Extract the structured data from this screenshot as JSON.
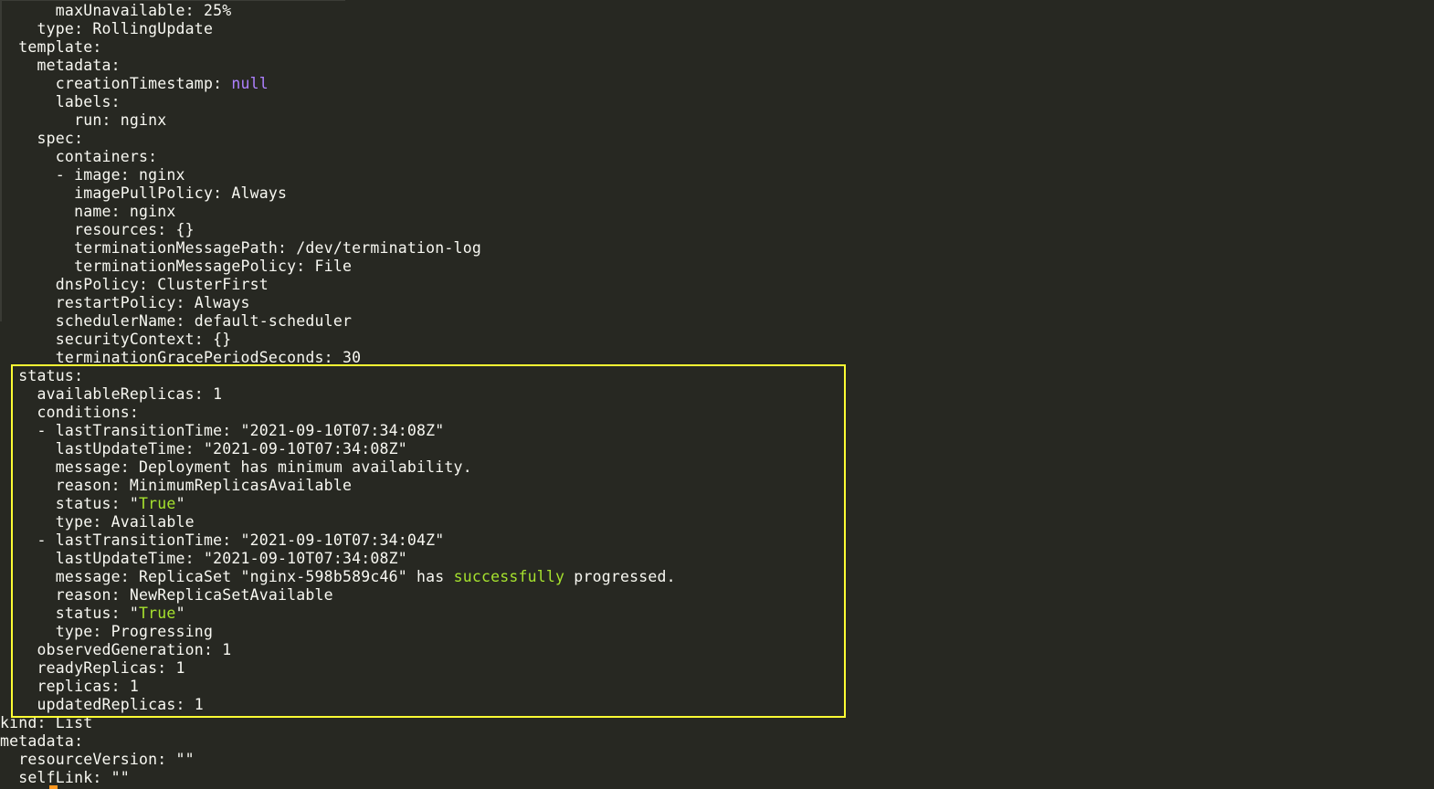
{
  "terminal": {
    "lines": [
      [
        {
          "t": "      maxUnavailable: 25%",
          "c": "text"
        }
      ],
      [
        {
          "t": "    type: RollingUpdate",
          "c": "text"
        }
      ],
      [
        {
          "t": "  template:",
          "c": "text"
        }
      ],
      [
        {
          "t": "    metadata:",
          "c": "text"
        }
      ],
      [
        {
          "t": "      creationTimestamp: ",
          "c": "text"
        },
        {
          "t": "null",
          "c": "null"
        }
      ],
      [
        {
          "t": "      labels:",
          "c": "text"
        }
      ],
      [
        {
          "t": "        run: nginx",
          "c": "text"
        }
      ],
      [
        {
          "t": "    spec:",
          "c": "text"
        }
      ],
      [
        {
          "t": "      containers:",
          "c": "text"
        }
      ],
      [
        {
          "t": "      - image: nginx",
          "c": "text"
        }
      ],
      [
        {
          "t": "        imagePullPolicy: Always",
          "c": "text"
        }
      ],
      [
        {
          "t": "        name: nginx",
          "c": "text"
        }
      ],
      [
        {
          "t": "        resources: {}",
          "c": "text"
        }
      ],
      [
        {
          "t": "        terminationMessagePath: /dev/termination-log",
          "c": "text"
        }
      ],
      [
        {
          "t": "        terminationMessagePolicy: File",
          "c": "text"
        }
      ],
      [
        {
          "t": "      dnsPolicy: ClusterFirst",
          "c": "text"
        }
      ],
      [
        {
          "t": "      restartPolicy: Always",
          "c": "text"
        }
      ],
      [
        {
          "t": "      schedulerName: default-scheduler",
          "c": "text"
        }
      ],
      [
        {
          "t": "      securityContext: {}",
          "c": "text"
        }
      ],
      [
        {
          "t": "      terminationGracePeriodSeconds: 30",
          "c": "text"
        }
      ],
      [
        {
          "t": "  status:",
          "c": "text"
        }
      ],
      [
        {
          "t": "    availableReplicas: 1",
          "c": "text"
        }
      ],
      [
        {
          "t": "    conditions:",
          "c": "text"
        }
      ],
      [
        {
          "t": "    - lastTransitionTime: \"2021-09-10T07:34:08Z\"",
          "c": "text"
        }
      ],
      [
        {
          "t": "      lastUpdateTime: \"2021-09-10T07:34:08Z\"",
          "c": "text"
        }
      ],
      [
        {
          "t": "      message: Deployment has minimum availability.",
          "c": "text"
        }
      ],
      [
        {
          "t": "      reason: MinimumReplicasAvailable",
          "c": "text"
        }
      ],
      [
        {
          "t": "      status: \"",
          "c": "text"
        },
        {
          "t": "True",
          "c": "green"
        },
        {
          "t": "\"",
          "c": "text"
        }
      ],
      [
        {
          "t": "      type: Available",
          "c": "text"
        }
      ],
      [
        {
          "t": "    - lastTransitionTime: \"2021-09-10T07:34:04Z\"",
          "c": "text"
        }
      ],
      [
        {
          "t": "      lastUpdateTime: \"2021-09-10T07:34:08Z\"",
          "c": "text"
        }
      ],
      [
        {
          "t": "      message: ReplicaSet \"nginx-598b589c46\" has ",
          "c": "text"
        },
        {
          "t": "successfully",
          "c": "green"
        },
        {
          "t": " progressed.",
          "c": "text"
        }
      ],
      [
        {
          "t": "      reason: NewReplicaSetAvailable",
          "c": "text"
        }
      ],
      [
        {
          "t": "      status: \"",
          "c": "text"
        },
        {
          "t": "True",
          "c": "green"
        },
        {
          "t": "\"",
          "c": "text"
        }
      ],
      [
        {
          "t": "      type: Progressing",
          "c": "text"
        }
      ],
      [
        {
          "t": "    observedGeneration: 1",
          "c": "text"
        }
      ],
      [
        {
          "t": "    readyReplicas: 1",
          "c": "text"
        }
      ],
      [
        {
          "t": "    replicas: 1",
          "c": "text"
        }
      ],
      [
        {
          "t": "    updatedReplicas: 1",
          "c": "text"
        }
      ],
      [
        {
          "t": "kind: List",
          "c": "text"
        }
      ],
      [
        {
          "t": "metadata:",
          "c": "text"
        }
      ],
      [
        {
          "t": "  resourceVersion: \"\"",
          "c": "text"
        }
      ],
      [
        {
          "t": "  selfLink: \"\"",
          "c": "text"
        }
      ]
    ]
  },
  "colors": {
    "background": "#272822",
    "text": "#f8f8f2",
    "null": "#ae81ff",
    "green": "#a6e22e",
    "highlight_border": "#ffff33"
  }
}
